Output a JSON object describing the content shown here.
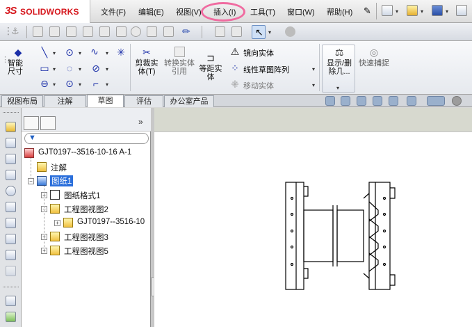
{
  "app": {
    "logo_ds": "3S",
    "logo_text": "SOLIDWORKS"
  },
  "menu": [
    "文件(F)",
    "编辑(E)",
    "视图(V)",
    "插入(I)",
    "工具(T)",
    "窗口(W)",
    "帮助(H)"
  ],
  "highlight_color": "#f06ba0",
  "command_manager": {
    "smart_dimension": "智能尺寸",
    "trim": "剪裁实体(T)",
    "convert": "转换实体引用",
    "offset": "等距实体",
    "mirror": "镜向实体",
    "linear_pattern": "线性草图阵列",
    "move": "移动实体",
    "display_delete": "显示/删除几...",
    "quick_snap": "快速捕捉"
  },
  "tabs": [
    "视图布局",
    "注解",
    "草图",
    "评估",
    "办公室产品"
  ],
  "active_tab": "草图",
  "tree": {
    "root": "GJT0197--3516-10-16 A-1",
    "annotations": "注解",
    "sheet": "图纸1",
    "sheet_format": "图纸格式1",
    "view2": "工程图视图2",
    "view2_child": "GJT0197--3516-10",
    "view3": "工程图视图3",
    "view5": "工程图视图5"
  },
  "selection_color": "#2b6fdb",
  "brand_color": "#d6161c"
}
